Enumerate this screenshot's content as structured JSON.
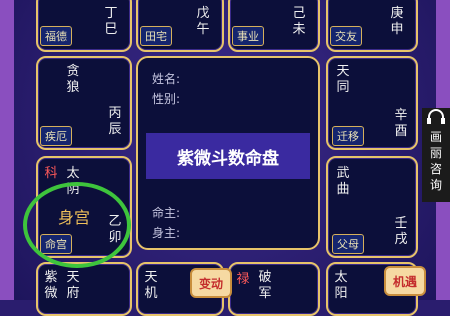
{
  "cells": {
    "top_left": {
      "chars": [
        "丁",
        "巳"
      ],
      "tag": "福德"
    },
    "top_mid1": {
      "chars": [
        "戊",
        "午"
      ],
      "tag": "田宅"
    },
    "top_mid2": {
      "chars": [
        "己",
        "未"
      ],
      "tag": "事业"
    },
    "top_right": {
      "chars": [
        "庚",
        "申"
      ],
      "tag": "交友"
    },
    "mid_left": {
      "stars": [
        "贪",
        "狼"
      ],
      "chars": [
        "丙",
        "辰"
      ],
      "tag": "疾厄"
    },
    "mid_right": {
      "stars": [
        "天",
        "同"
      ],
      "chars": [
        "辛",
        "酉"
      ],
      "tag": "迁移"
    },
    "low_left": {
      "mark": "科",
      "stars": [
        "太",
        "阴"
      ],
      "label": "身宫",
      "chars": [
        "乙",
        "卯"
      ],
      "tag": "命宫"
    },
    "low_right": {
      "stars": [
        "武",
        "曲"
      ],
      "chars": [
        "壬",
        "戌"
      ],
      "tag": "父母"
    },
    "bottom_1": {
      "stars": [
        "紫",
        "微"
      ],
      "stars2": [
        "天",
        "府"
      ]
    },
    "bottom_2": {
      "stars": [
        "天",
        "机"
      ]
    },
    "bottom_3": {
      "mark": "禄",
      "stars": [
        "破",
        "军"
      ]
    },
    "bottom_4": {
      "stars": [
        "太",
        "阳"
      ]
    }
  },
  "center": {
    "name_label": "姓名:",
    "gender_label": "性别:",
    "title": "紫微斗数命盘",
    "ming_label": "命主:",
    "shen_label": "身主:"
  },
  "badges": {
    "change": "变动",
    "opportunity": "机遇"
  },
  "side_tag": {
    "text": [
      "画",
      "丽",
      "咨",
      "询"
    ],
    "icon": "headset-icon"
  },
  "colors": {
    "background": "#2a1d6e",
    "cell_fill": "#0c0f3a",
    "border_gold": "#e7c46a",
    "tag_blue": "#15256e",
    "highlight_green": "#3ec43c",
    "mark_red": "#ff5a5a"
  }
}
